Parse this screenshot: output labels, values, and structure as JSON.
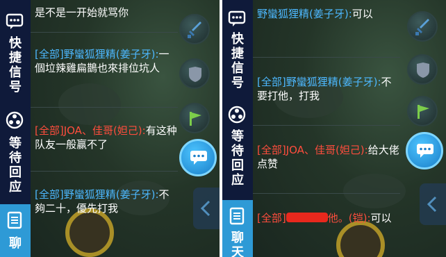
{
  "colors": {
    "tab_bg": "#0f1a3a",
    "tab_active": "#2e9ad6",
    "sender_blue": "#4db8ff",
    "sender_red": "#ff4d3d",
    "message_text": "#ffffff"
  },
  "left": {
    "tabs": [
      {
        "icon": "quick-message-icon",
        "label": [
          "快",
          "捷",
          "信",
          "号"
        ]
      },
      {
        "icon": "waiting-icon",
        "label": [
          "等",
          "待",
          "回",
          "应"
        ]
      },
      {
        "icon": "chat-list-icon",
        "label": [
          "聊"
        ]
      }
    ],
    "messages": [
      {
        "sender": "",
        "text": "是不是一开始就骂你"
      },
      {
        "channel": "[全部]",
        "sender": "野蠻狐狸精(姜子牙)",
        "text": "一個垃辣雞扁鵲也來排位坑人"
      },
      {
        "channel": "[全部]",
        "sender": "JOA、佳哥(妲己)",
        "text": "有这种队友一般赢不了"
      },
      {
        "channel": "[全部]",
        "sender": "野蠻狐狸精(姜子牙)",
        "text": "不夠二十，優先打我"
      }
    ]
  },
  "right": {
    "tabs": [
      {
        "icon": "quick-message-icon",
        "label": [
          "快",
          "捷",
          "信",
          "号"
        ]
      },
      {
        "icon": "waiting-icon",
        "label": [
          "等",
          "待",
          "回",
          "应"
        ]
      },
      {
        "icon": "chat-list-icon",
        "label": [
          "聊",
          "天"
        ]
      }
    ],
    "messages": [
      {
        "sender": "野蠻狐狸精(姜子牙)",
        "text": "可以"
      },
      {
        "channel": "[全部]",
        "sender": "野蠻狐狸精(姜子牙)",
        "text": "不要打他，打我"
      },
      {
        "channel": "[全部]",
        "sender": "JOA、佳哥(妲己)",
        "text": "给大佬点赞"
      },
      {
        "channel": "[全部]",
        "sender_suffix": "他。(铠)",
        "text": "可以"
      }
    ]
  },
  "game_icons": [
    "sword-icon",
    "shield-icon",
    "flag-icon",
    "chat-bubble-icon"
  ]
}
